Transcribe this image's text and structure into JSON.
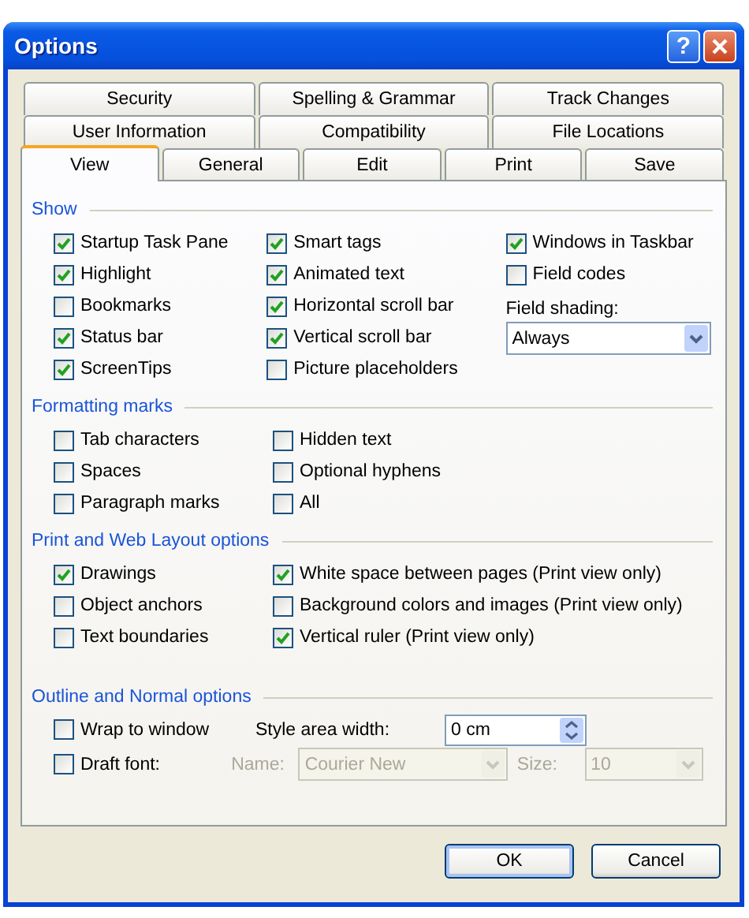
{
  "window": {
    "title": "Options",
    "help_label": "?"
  },
  "tab_rows": [
    [
      {
        "label": "Security",
        "selected": false
      },
      {
        "label": "Spelling & Grammar",
        "selected": false
      },
      {
        "label": "Track Changes",
        "selected": false
      }
    ],
    [
      {
        "label": "User Information",
        "selected": false
      },
      {
        "label": "Compatibility",
        "selected": false
      },
      {
        "label": "File Locations",
        "selected": false
      }
    ],
    [
      {
        "label": "View",
        "selected": true
      },
      {
        "label": "General",
        "selected": false
      },
      {
        "label": "Edit",
        "selected": false
      },
      {
        "label": "Print",
        "selected": false
      },
      {
        "label": "Save",
        "selected": false
      }
    ]
  ],
  "sections": [
    {
      "title": "Show",
      "columns": [
        [
          {
            "kind": "checkbox",
            "label": "Startup Task Pane",
            "checked": true
          },
          {
            "kind": "checkbox",
            "label": "Highlight",
            "checked": true
          },
          {
            "kind": "checkbox",
            "label": "Bookmarks",
            "checked": false
          },
          {
            "kind": "checkbox",
            "label": "Status bar",
            "checked": true
          },
          {
            "kind": "checkbox",
            "label": "ScreenTips",
            "checked": true
          }
        ],
        [
          {
            "kind": "checkbox",
            "label": "Smart tags",
            "checked": true
          },
          {
            "kind": "checkbox",
            "label": "Animated text",
            "checked": true
          },
          {
            "kind": "checkbox",
            "label": "Horizontal scroll bar",
            "checked": true
          },
          {
            "kind": "checkbox",
            "label": "Vertical scroll bar",
            "checked": true
          },
          {
            "kind": "checkbox",
            "label": "Picture placeholders",
            "checked": false
          }
        ],
        [
          {
            "kind": "checkbox",
            "label": "Windows in Taskbar",
            "checked": true
          },
          {
            "kind": "checkbox",
            "label": "Field codes",
            "checked": false
          },
          {
            "kind": "label",
            "label": "Field shading:"
          },
          {
            "kind": "dropdown",
            "value": "Always",
            "disabled": false
          }
        ]
      ]
    },
    {
      "title": "Formatting marks",
      "columns": [
        [
          {
            "kind": "checkbox",
            "label": "Tab characters",
            "checked": false
          },
          {
            "kind": "checkbox",
            "label": "Spaces",
            "checked": false
          },
          {
            "kind": "checkbox",
            "label": "Paragraph marks",
            "checked": false
          }
        ],
        [
          {
            "kind": "checkbox",
            "label": "Hidden text",
            "checked": false
          },
          {
            "kind": "checkbox",
            "label": "Optional hyphens",
            "checked": false
          },
          {
            "kind": "checkbox",
            "label": "All",
            "checked": false
          }
        ]
      ]
    },
    {
      "title": "Print and Web Layout options",
      "columns": [
        [
          {
            "kind": "checkbox",
            "label": "Drawings",
            "checked": true
          },
          {
            "kind": "checkbox",
            "label": "Object anchors",
            "checked": false
          },
          {
            "kind": "checkbox",
            "label": "Text boundaries",
            "checked": false
          }
        ],
        [
          {
            "kind": "checkbox",
            "label": "White space between pages (Print view only)",
            "checked": true
          },
          {
            "kind": "checkbox",
            "label": "Background colors and images (Print view only)",
            "checked": false
          },
          {
            "kind": "checkbox",
            "label": "Vertical ruler (Print view only)",
            "checked": true
          }
        ]
      ]
    },
    {
      "title": "Outline and Normal options",
      "outline": {
        "wrap_to_window": {
          "label": "Wrap to window",
          "checked": false
        },
        "style_area_width": {
          "label": "Style area width:",
          "value": "0 cm"
        },
        "draft_font": {
          "label": "Draft font:",
          "checked": false
        },
        "font_name": {
          "label": "Name:",
          "value": "Courier New",
          "disabled": true
        },
        "font_size": {
          "label": "Size:",
          "value": "10",
          "disabled": true
        }
      }
    }
  ],
  "buttons": [
    {
      "label": "OK",
      "default": true
    },
    {
      "label": "Cancel",
      "default": false
    }
  ]
}
